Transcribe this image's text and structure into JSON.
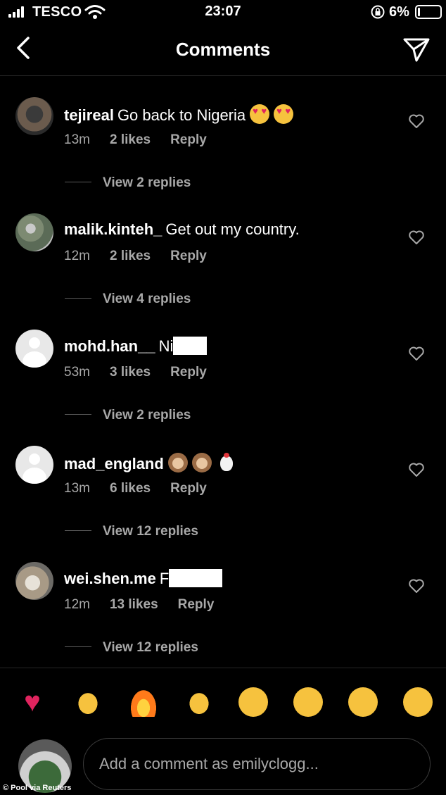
{
  "status_bar": {
    "carrier": "TESCO",
    "time": "23:07",
    "battery": "6%"
  },
  "header": {
    "title": "Comments"
  },
  "comments": [
    {
      "username": "tejireal",
      "text": "Go back to Nigeria",
      "emojis": [
        "smiling-face-with-heart-eyes",
        "smiling-face-with-heart-eyes"
      ],
      "time": "13m",
      "likes": "2 likes",
      "reply": "Reply",
      "view_replies": "View 2 replies"
    },
    {
      "username": "malik.kinteh_",
      "text": "Get out my country.",
      "time": "12m",
      "likes": "2 likes",
      "reply": "Reply",
      "view_replies": "View 4 replies"
    },
    {
      "username": "mohd.han__",
      "text": "Ni",
      "redacted": true,
      "time": "53m",
      "likes": "3 likes",
      "reply": "Reply",
      "view_replies": "View 2 replies"
    },
    {
      "username": "mad_england",
      "text": "",
      "emojis": [
        "monkey-face",
        "monkey-face",
        "chicken"
      ],
      "time": "13m",
      "likes": "6 likes",
      "reply": "Reply",
      "view_replies": "View 12 replies"
    },
    {
      "username": "wei.shen.me",
      "text": "F",
      "redacted": true,
      "time": "12m",
      "likes": "13 likes",
      "reply": "Reply",
      "view_replies": "View 12 replies"
    }
  ],
  "quick_reactions": [
    "red-heart",
    "raising-hands",
    "fire",
    "clapping-hands",
    "crying-face",
    "smiling-face-with-heart-eyes",
    "face-with-open-mouth",
    "face-with-tears-of-joy"
  ],
  "composer": {
    "placeholder": "Add a comment as emilyclogg..."
  },
  "credit": "© Pool via Reuters",
  "colors": {
    "background": "#000000",
    "secondary_text": "#a8a8a8",
    "divider": "#262626"
  }
}
